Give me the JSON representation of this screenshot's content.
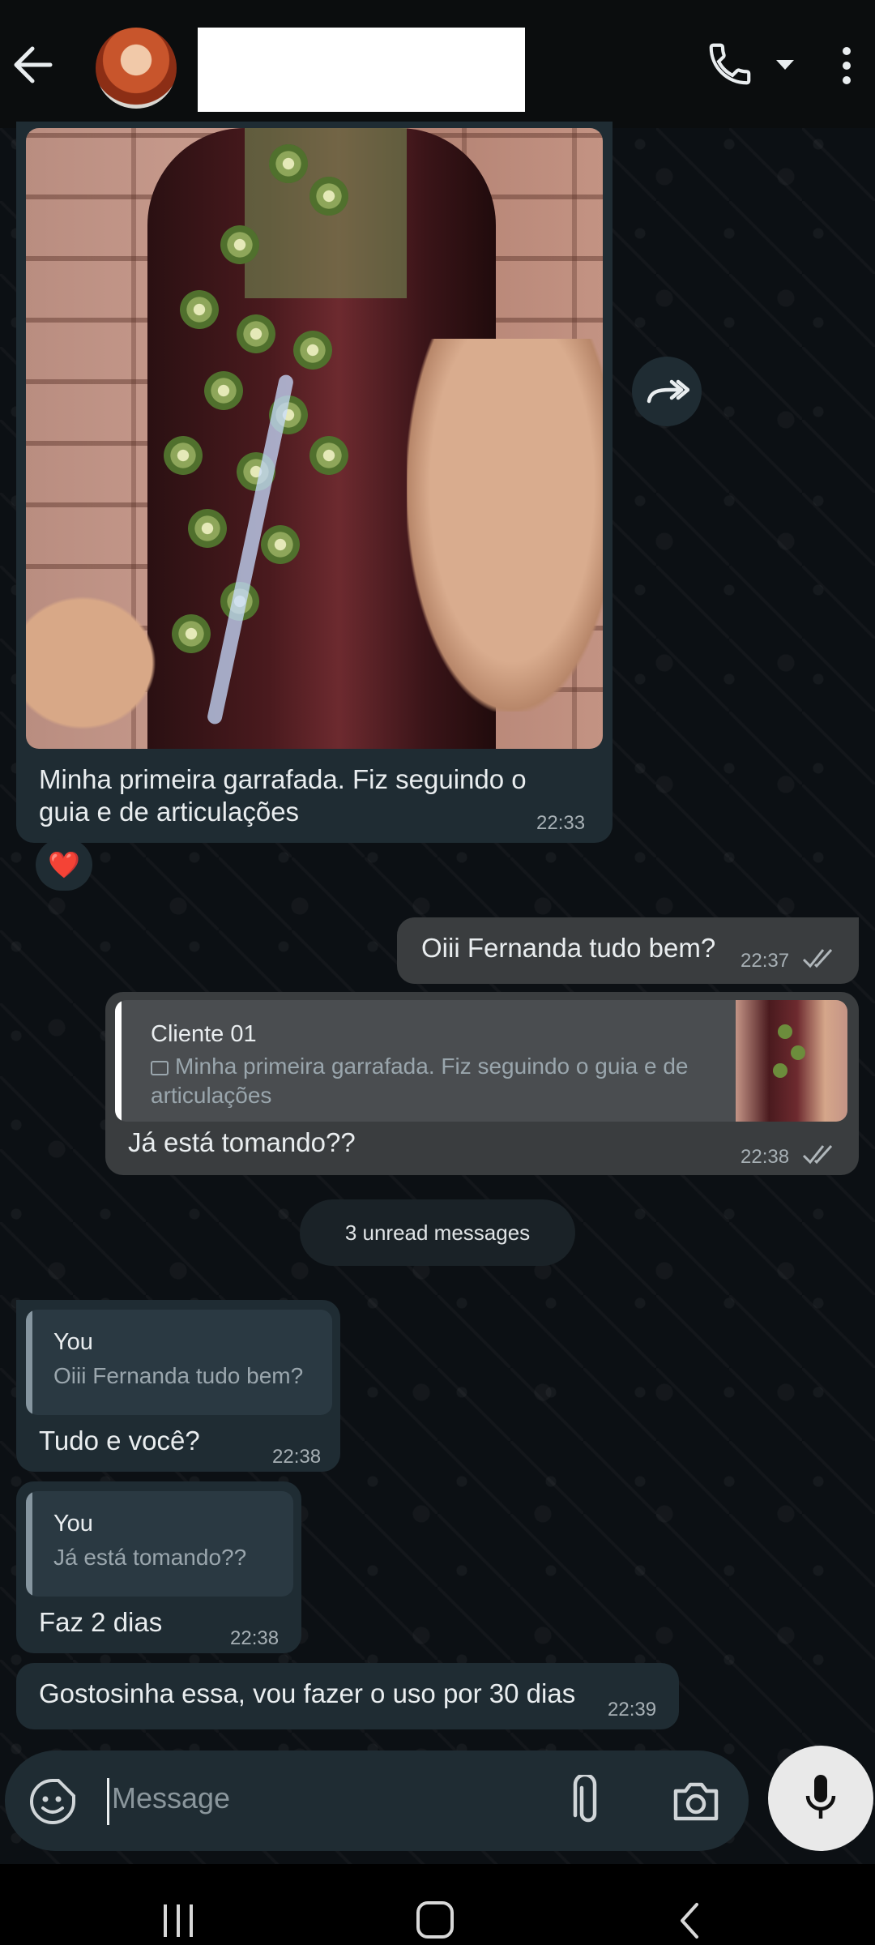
{
  "header": {
    "contact_name": "",
    "icons": [
      "back-arrow-icon",
      "phone-icon",
      "caret-down-icon",
      "more-vert-icon"
    ]
  },
  "messages": [
    {
      "direction": "in",
      "type": "image",
      "caption": "Minha primeira garrafada. Fiz seguindo o guia e de articulações",
      "time": "22:33",
      "reaction": "❤️"
    },
    {
      "direction": "out",
      "text": "Oiii Fernanda tudo bem?",
      "time": "22:37"
    },
    {
      "direction": "out",
      "reply_to": {
        "name": "Cliente 01",
        "text": "Minha primeira garrafada. Fiz seguindo o guia e de articulações"
      },
      "text": "Já está tomando??",
      "time": "22:38"
    },
    {
      "direction": "in",
      "reply_to": {
        "name": "You",
        "text": "Oiii Fernanda tudo bem?"
      },
      "text": "Tudo e você?",
      "time": "22:38"
    },
    {
      "direction": "in",
      "reply_to": {
        "name": "You",
        "text": "Já está tomando??"
      },
      "text": "Faz 2 dias",
      "time": "22:38"
    },
    {
      "direction": "in",
      "text": "Gostosinha essa, vou fazer o uso por 30 dias",
      "time": "22:39"
    }
  ],
  "unread_banner": "3 unread messages",
  "composer": {
    "placeholder": "Message",
    "icons": [
      "emoji-sticker-icon",
      "attach-clip-icon",
      "camera-icon",
      "mic-icon"
    ]
  },
  "colors": {
    "incoming_bubble": "#1f2c33",
    "outgoing_bubble": "#3a3d3f",
    "background": "#0b0d0e"
  }
}
